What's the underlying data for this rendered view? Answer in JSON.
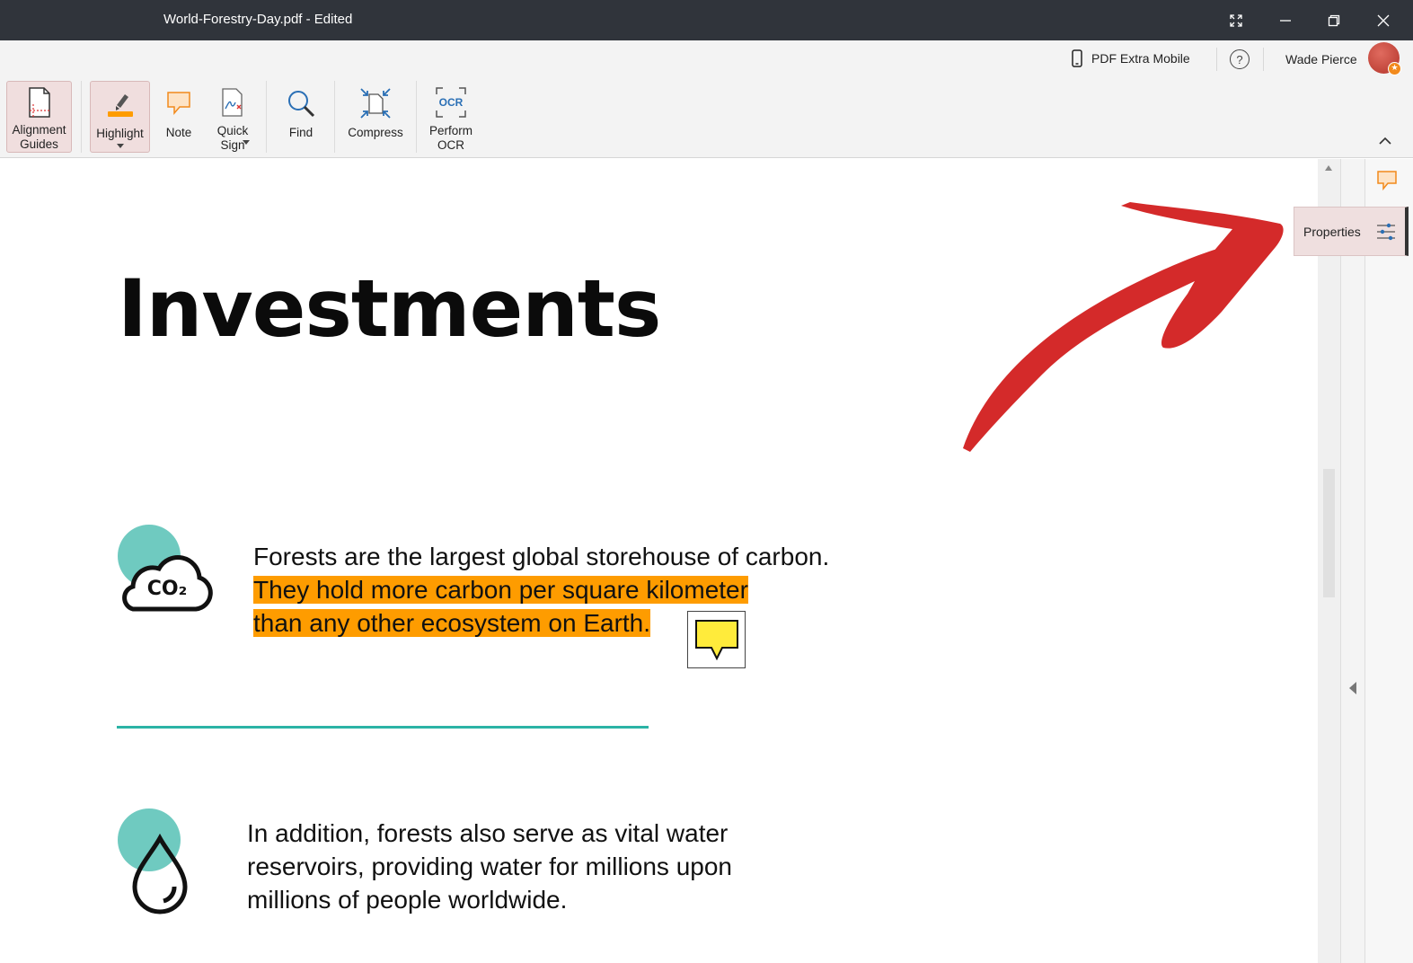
{
  "window": {
    "title": "World-Forestry-Day.pdf - Edited"
  },
  "account": {
    "mobile_label": "PDF Extra Mobile",
    "help_label": "?",
    "user_name": "Wade Pierce"
  },
  "toolbar": {
    "alignment_guides": "Alignment Guides",
    "highlight": "Highlight",
    "note": "Note",
    "quick_sign": "Quick Sign",
    "find": "Find",
    "compress": "Compress",
    "perform_ocr": "Perform OCR",
    "ocr_icon_text": "OCR"
  },
  "document": {
    "heading": "Investments",
    "co2_icon_text": "CO₂",
    "para1_line1": "Forests are the largest global storehouse of carbon.",
    "para1_line2": "They hold more carbon per square kilometer",
    "para1_line3": "than any other ecosystem on Earth.",
    "para2_line1": "In addition, forests also serve as vital water",
    "para2_line2": "reservoirs, providing water for millions upon",
    "para2_line3": "millions of people worldwide."
  },
  "sidebar": {
    "properties": "Properties"
  },
  "colors": {
    "titlebar": "#30343b",
    "highlight": "#fe9c00",
    "note": "#ffeb3b",
    "teal": "#6fcac0",
    "arrow": "#d42a2a"
  }
}
